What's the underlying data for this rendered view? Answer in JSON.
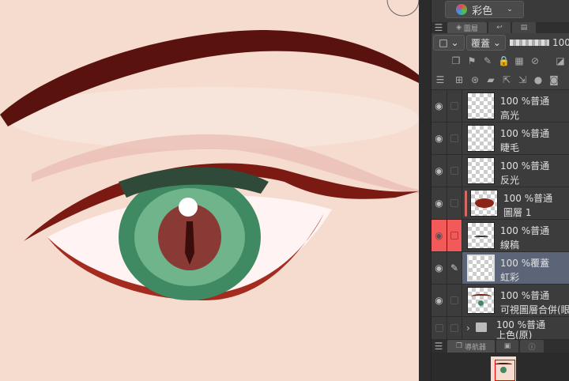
{
  "color_mode": {
    "label": "彩色"
  },
  "panel_tabs": {
    "layers": "圖層",
    "navigator": "導航器"
  },
  "blend": {
    "mode": "覆蓋",
    "opacity": "100"
  },
  "layers": [
    {
      "opacity": "100 %",
      "mode": "普通",
      "name": "高光"
    },
    {
      "opacity": "100 %",
      "mode": "普通",
      "name": "睫毛"
    },
    {
      "opacity": "100 %",
      "mode": "普通",
      "name": "反光"
    },
    {
      "opacity": "100 %",
      "mode": "普通",
      "name": "圖層 1"
    },
    {
      "opacity": "100 %",
      "mode": "普通",
      "name": "線稿"
    },
    {
      "opacity": "100 %",
      "mode": "覆蓋",
      "name": "虹彩"
    },
    {
      "opacity": "100 %",
      "mode": "普通",
      "name": "可視圖層合併(眼珠"
    },
    {
      "opacity": "100 %",
      "mode": "普通",
      "name": "上色(原)"
    }
  ],
  "colors": {
    "canvas": "#f5dccf",
    "line": "#6e1510",
    "iris": "#3f8a62",
    "selected": "#5c6578",
    "highlight": "#f25a5a"
  }
}
